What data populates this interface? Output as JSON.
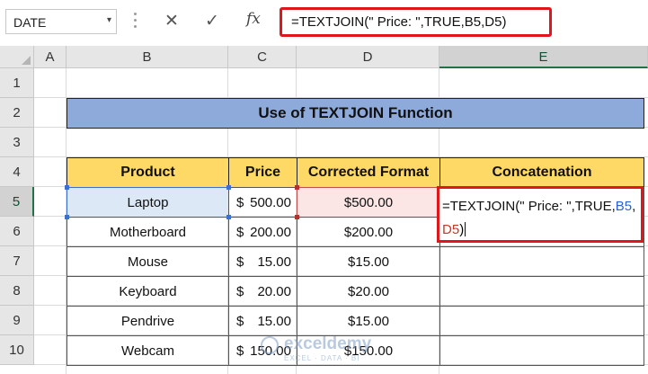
{
  "namebox": {
    "value": "DATE",
    "arrow": "▾"
  },
  "formula_bar": {
    "cancel_glyph": "✕",
    "enter_glyph": "✓",
    "fx_label": "fx",
    "formula": "=TEXTJOIN(\" Price: \",TRUE,B5,D5)"
  },
  "columns": [
    "A",
    "B",
    "C",
    "D",
    "E"
  ],
  "rows": [
    "1",
    "2",
    "3",
    "4",
    "5",
    "6",
    "7",
    "8",
    "9",
    "10"
  ],
  "selected": {
    "column": "E",
    "row": "5"
  },
  "sheet": {
    "title": "Use of TEXTJOIN Function",
    "headers": [
      "Product",
      "Price",
      "Corrected Format",
      "Concatenation"
    ],
    "data": [
      {
        "product": "Laptop",
        "price_symbol": "$",
        "price_value": "500.00",
        "corrected": "$500.00"
      },
      {
        "product": "Motherboard",
        "price_symbol": "$",
        "price_value": "200.00",
        "corrected": "$200.00"
      },
      {
        "product": "Mouse",
        "price_symbol": "$",
        "price_value": "15.00",
        "corrected": "$15.00"
      },
      {
        "product": "Keyboard",
        "price_symbol": "$",
        "price_value": "20.00",
        "corrected": "$20.00"
      },
      {
        "product": "Pendrive",
        "price_symbol": "$",
        "price_value": "15.00",
        "corrected": "$15.00"
      },
      {
        "product": "Webcam",
        "price_symbol": "$",
        "price_value": "150.00",
        "corrected": "$150.00"
      }
    ],
    "editing": {
      "line1_text": "=TEXTJOIN(\" Price: \",TRUE,",
      "line1_ref": "B5",
      "line1_comma": ",",
      "line2_ref": "D5",
      "line2_close": ")"
    }
  },
  "watermark": {
    "name": "exceldemy",
    "tagline": "EXCEL · DATA · BI"
  },
  "colors": {
    "title_fill": "#8eaadb",
    "header_fill": "#ffd966",
    "highlight_red": "#e0161b",
    "ref_blue": "#2f5fd0",
    "ref_red": "#c0392b"
  }
}
